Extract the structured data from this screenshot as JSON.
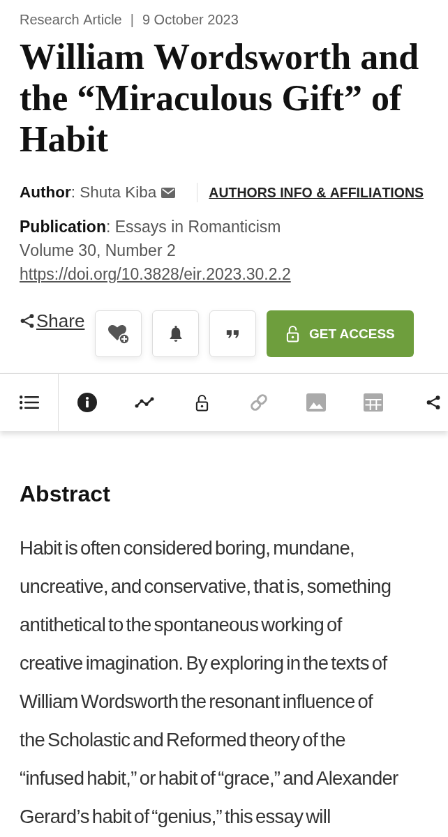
{
  "meta": {
    "type": "Research Article",
    "separator": "|",
    "date": "9 October 2023"
  },
  "title": "William Wordsworth and the “Miraculous Gift” of Habit",
  "author": {
    "text": "**Author**: Shuta Kiba",
    "link": "AUTHORS INFO & AFFILIATIONS"
  },
  "publication": {
    "text": "**Publication**: Essays in Romanticism",
    "issue": "Volume 30, Number 2",
    "doi": "https://doi.org/10.3828/eir.2023.30.2.2"
  },
  "actions": {
    "share": "Share",
    "buttons": [
      {
        "kind": "favorite"
      },
      {
        "kind": "alert"
      },
      {
        "kind": "cite"
      }
    ],
    "access": "GET ACCESS"
  },
  "toolbar": [
    {
      "kind": "contents",
      "disabled": false
    },
    {
      "kind": "info",
      "disabled": false
    },
    {
      "kind": "metrics",
      "disabled": false
    },
    {
      "kind": "access",
      "disabled": false
    },
    {
      "kind": "links",
      "disabled": true
    },
    {
      "kind": "figures",
      "disabled": true
    },
    {
      "kind": "tables",
      "disabled": true
    },
    {
      "kind": "share",
      "disabled": false
    }
  ],
  "abstract": {
    "heading": "Abstract",
    "text": "Habit is often considered boring, mundane, uncreative, and conservative, that is, something antithetical to the spontaneous working of creative imagination. By exploring in the texts of William Wordsworth the resonant influence of the Scholastic and Reformed theory of the “infused habit,” or habit of “grace,” and Alexander Gerard’s habit of “genius,” this essay will"
  }
}
